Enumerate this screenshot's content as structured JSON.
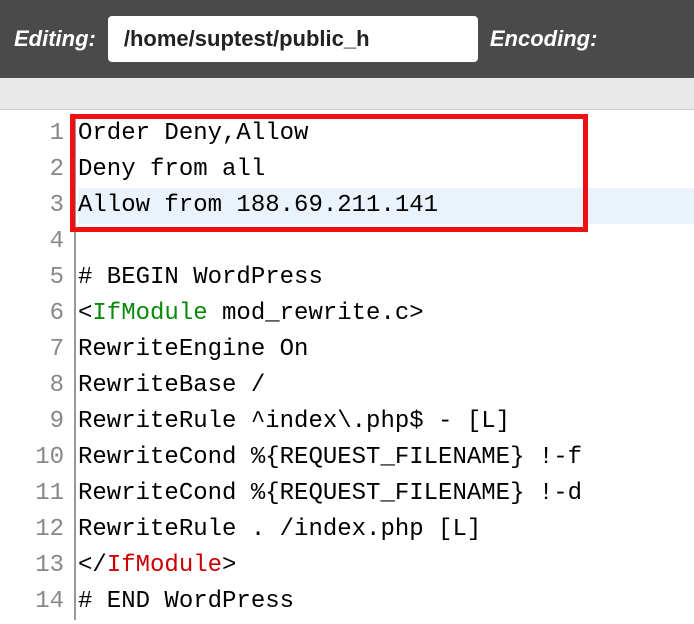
{
  "toolbar": {
    "editing_label": "Editing:",
    "path_value": "/home/suptest/public_h",
    "encoding_label": "Encoding:"
  },
  "gutter": {
    "l1": "1",
    "l2": "2",
    "l3": "3",
    "l4": "4",
    "l5": "5",
    "l6": "6",
    "l7": "7",
    "l8": "8",
    "l9": "9",
    "l10": "10",
    "l11": "11",
    "l12": "12",
    "l13": "13",
    "l14": "14"
  },
  "code": {
    "l1": "Order Deny,Allow",
    "l2": "Deny from all",
    "l3": "Allow from 188.69.211.141",
    "l4": "",
    "l5": "# BEGIN WordPress",
    "l6_open": "<",
    "l6_tag": "IfModule",
    "l6_rest": " mod_rewrite.c>",
    "l7": "RewriteEngine On",
    "l8": "RewriteBase /",
    "l9": "RewriteRule ^index\\.php$ - [L]",
    "l10": "RewriteCond %{REQUEST_FILENAME} !-f",
    "l11": "RewriteCond %{REQUEST_FILENAME} !-d",
    "l12": "RewriteRule . /index.php [L]",
    "l13_open": "</",
    "l13_tag": "IfModule",
    "l13_close": ">",
    "l14": "# END WordPress"
  }
}
